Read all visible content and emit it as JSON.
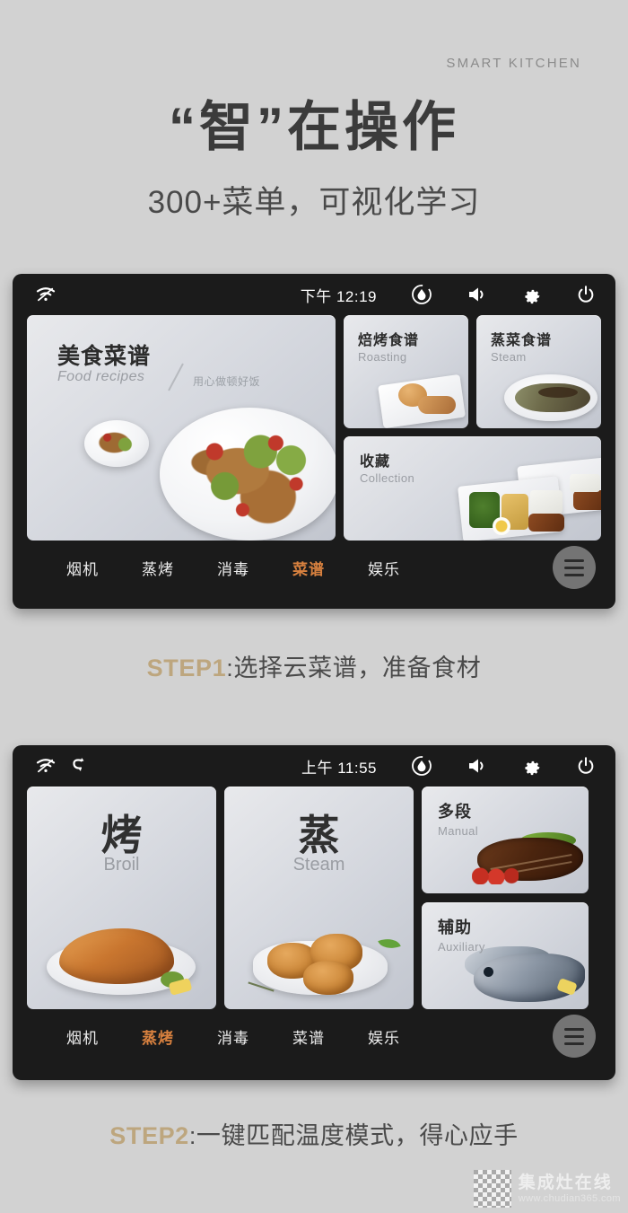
{
  "header": {
    "eyebrow": "SMART  KITCHEN",
    "headline": "“智”在操作",
    "subline": "300+菜单，可视化学习"
  },
  "screen1": {
    "statusbar": {
      "wifi_icon": "wifi-off-icon",
      "clock": "下午 12:19",
      "humidity_icon": "water-drop-icon",
      "volume_icon": "volume-icon",
      "settings_icon": "gear-icon",
      "power_icon": "power-icon"
    },
    "cards": {
      "main": {
        "title": "美食菜谱",
        "subtitle": "Food recipes",
        "tagline": "用心做顿好饭"
      },
      "roasting": {
        "title": "焙烤食谱",
        "subtitle": "Roasting"
      },
      "steam": {
        "title": "蒸菜食谱",
        "subtitle": "Steam"
      },
      "collection": {
        "title": "收藏",
        "subtitle": "Collection"
      }
    },
    "nav": {
      "items": [
        {
          "label": "烟机",
          "active": false
        },
        {
          "label": "蒸烤",
          "active": false
        },
        {
          "label": "消毒",
          "active": false
        },
        {
          "label": "菜谱",
          "active": true
        },
        {
          "label": "娱乐",
          "active": false
        }
      ],
      "menu_icon": "hamburger-menu-icon"
    }
  },
  "step1": {
    "key": "STEP1",
    "text": ":选择云菜谱，准备食材"
  },
  "screen2": {
    "statusbar": {
      "wifi_icon": "wifi-off-icon",
      "sync_icon": "refresh-icon",
      "clock": "上午 11:55",
      "humidity_icon": "water-drop-icon",
      "volume_icon": "volume-icon",
      "settings_icon": "gear-icon",
      "power_icon": "power-icon"
    },
    "cards": {
      "broil": {
        "title": "烤",
        "subtitle": "Broil"
      },
      "steam": {
        "title": "蒸",
        "subtitle": "Steam"
      },
      "manual": {
        "title": "多段",
        "subtitle": "Manual"
      },
      "auxiliary": {
        "title": "辅助",
        "subtitle": "Auxiliary"
      }
    },
    "nav": {
      "items": [
        {
          "label": "烟机",
          "active": false
        },
        {
          "label": "蒸烤",
          "active": true
        },
        {
          "label": "消毒",
          "active": false
        },
        {
          "label": "菜谱",
          "active": false
        },
        {
          "label": "娱乐",
          "active": false
        }
      ],
      "menu_icon": "hamburger-menu-icon"
    }
  },
  "step2": {
    "key": "STEP2",
    "text": ":一键匹配温度模式，得心应手"
  },
  "watermark": {
    "name": "集成灶在线",
    "url": "www.chudian365.com"
  },
  "colors": {
    "page_bg": "#d2d2d2",
    "bezel": "#1b1b1b",
    "accent_orange": "#d8813f",
    "step_gold": "#bda67e",
    "heading": "#3b3b3b"
  }
}
